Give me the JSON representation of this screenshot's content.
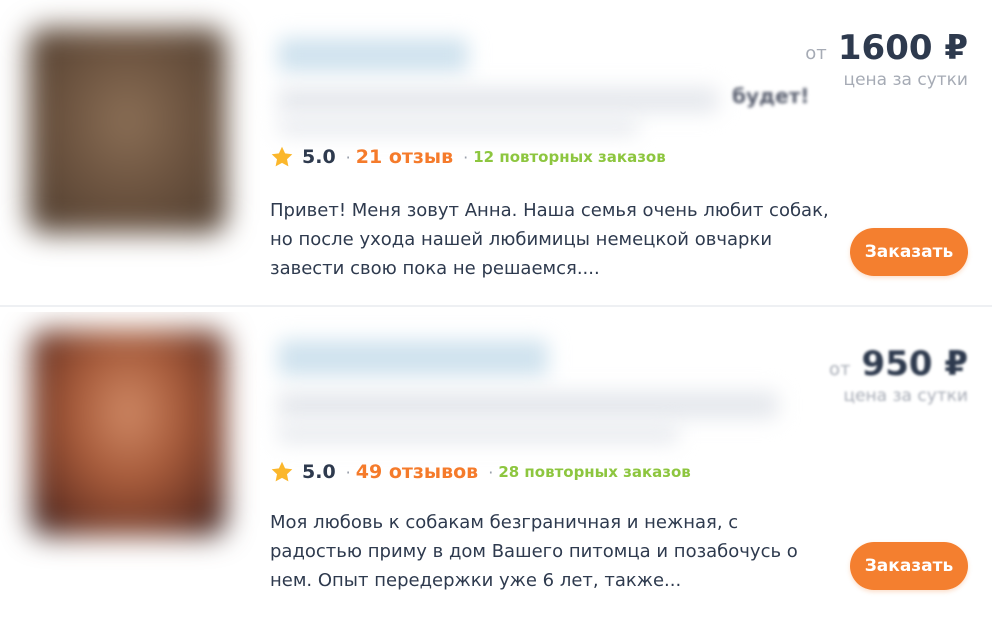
{
  "listings": [
    {
      "partial_heading": "будет!",
      "price": {
        "prefix": "от",
        "amount": "1600 ₽",
        "note": "цена за сутки"
      },
      "rating": {
        "score": "5.0",
        "reviews": "21 отзыв",
        "repeat_orders": "12 повторных заказов"
      },
      "description": "Привет! Меня зовут Анна. Наша семья очень любит собак, но после ухода нашей любимицы немецкой овчарки завести свою пока не решаемся....",
      "order_label": "Заказать"
    },
    {
      "price": {
        "prefix": "от",
        "amount": "950 ₽",
        "note": "цена за сутки"
      },
      "rating": {
        "score": "5.0",
        "reviews": "49 отзывов",
        "repeat_orders": "28 повторных заказов"
      },
      "description": "Моя любовь к собакам безграничная и нежная, с радостью приму в дом Вашего питомца и позабочусь о нем. Опыт передержки уже 6 лет, также...",
      "order_label": "Заказать"
    }
  ],
  "colors": {
    "accent": "#f47f2f",
    "reviews": "#f57b2b",
    "repeat_orders": "#8dc63f",
    "star": "#fbb72c",
    "text": "#2e3a4e",
    "muted": "#a6abb5"
  },
  "icons": {
    "rating": "star-icon"
  }
}
